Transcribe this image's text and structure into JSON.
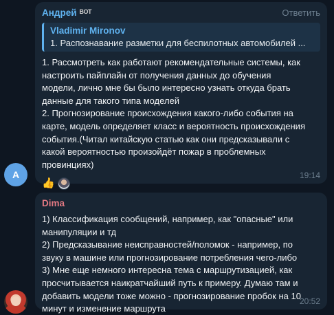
{
  "messages": [
    {
      "sender": "Андрей",
      "sender_badge": "BOT",
      "reply_label": "Ответить",
      "avatar_letter": "A",
      "quote": {
        "author": "Vladimir Mironov",
        "text": "1. Распознавание разметки для беспилотных автомобилей ..."
      },
      "text": "1. Рассмотреть как работают рекомендательные системы, как\nнастроить пайплайн от получения данных до обучения\nмодели, лично мне бы было интересно узнать откуда брать\nданные для такого типа моделей\n2. Прогнозирование происхождения какого-либо события на\nкарте, модель определяет класс и вероятность происхождения\nсобытия.(Читал китайскую статью как они предсказывали с\nкакой вероятностью произойдёт пожар в проблемных\nпровинциях)",
      "reaction": "👍",
      "time": "19:14"
    },
    {
      "sender": "Dima",
      "text": "1) Классификация сообщений, например, как \"опасные\" или\nманипуляции и тд\n2) Предсказывание неисправностей/поломок - например, по\nзвуку в машине или прогнозирование потребления чего-либо\n3) Мне еще немного интересна тема с маршрутизацией, как\nпросчитывается наикратчайший путь к примеру. Думаю там и\nдобавить модели тоже можно - прогнозирование пробок на 10\nминут и изменение маршрута",
      "time": "20:52"
    }
  ],
  "colors": {
    "background": "#0e1621",
    "bubble": "#182533",
    "andrey_name": "#5fb2ef",
    "dima_name": "#e37983",
    "meta": "#6d7f8f"
  }
}
